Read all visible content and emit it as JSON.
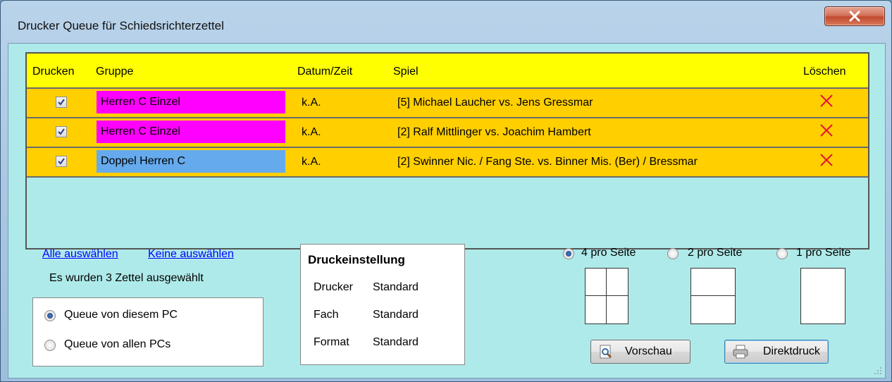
{
  "window": {
    "title": "Drucker Queue für Schiedsrichterzettel",
    "close_icon": "close-icon"
  },
  "grid": {
    "columns": [
      "Drucken",
      "Gruppe",
      "Datum/Zeit",
      "Spiel",
      "Löschen"
    ],
    "rows": [
      {
        "checked": true,
        "group": "Herren C Einzel",
        "group_color": "#ff00ff",
        "date": "k.A.",
        "match": "[5] Michael Laucher vs. Jens Gressmar"
      },
      {
        "checked": true,
        "group": "Herren C Einzel",
        "group_color": "#ff00ff",
        "date": "k.A.",
        "match": "[2] Ralf Mittlinger vs. Joachim Hambert"
      },
      {
        "checked": true,
        "group": "Doppel Herren C",
        "group_color": "#66aaee",
        "date": "k.A.",
        "match": "[2] Swinner Nic. / Fang Ste. vs. Binner Mis. (Ber) / Bressmar"
      }
    ],
    "header_color": "#ffff00",
    "row_color": "#ffcf00",
    "background_color": "#afeaea"
  },
  "selection": {
    "select_all": "Alle auswählen",
    "select_none": "Keine auswählen",
    "status": "Es wurden 3 Zettel ausgewählt"
  },
  "queue_options": [
    {
      "label": "Queue von diesem PC",
      "checked": true
    },
    {
      "label": "Queue von allen PCs",
      "checked": false
    }
  ],
  "print_settings": {
    "title": "Druckeinstellung",
    "rows": [
      {
        "key": "Drucker",
        "value": "Standard"
      },
      {
        "key": "Fach",
        "value": "Standard"
      },
      {
        "key": "Format",
        "value": "Standard"
      }
    ]
  },
  "layout_options": [
    {
      "label": "4 pro Seite",
      "checked": true
    },
    {
      "label": "2 pro Seite",
      "checked": false
    },
    {
      "label": "1 pro Seite",
      "checked": false
    }
  ],
  "buttons": {
    "preview": "Vorschau",
    "print": "Direktdruck"
  }
}
